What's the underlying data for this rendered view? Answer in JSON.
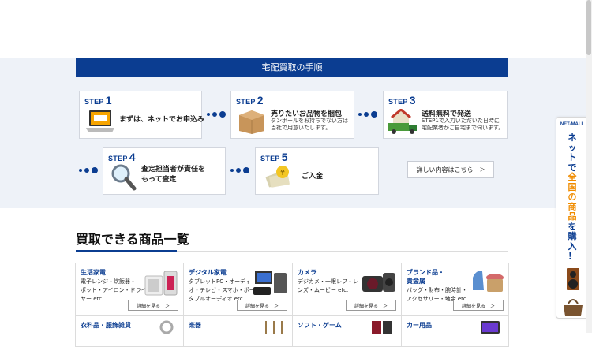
{
  "flow": {
    "heading": "宅配買取の手順",
    "steps": [
      {
        "label": "STEP",
        "num": "1",
        "title": "まずは、ネットでお申込み",
        "sub": ""
      },
      {
        "label": "STEP",
        "num": "2",
        "title": "売りたいお品物を梱包",
        "sub": "ダンボールをお持ちでない方は\n当社で用意いたします。"
      },
      {
        "label": "STEP",
        "num": "3",
        "title": "送料無料で発送",
        "sub": "STEP1で入力いただいた日時に\n宅配業者がご自宅まで伺います。"
      },
      {
        "label": "STEP",
        "num": "4",
        "title": "査定担当者が責任を\nもって査定",
        "sub": ""
      },
      {
        "label": "STEP",
        "num": "5",
        "title": "ご入金",
        "sub": ""
      }
    ],
    "detail_button": "詳しい内容はこちら",
    "detail_arrow": "＞"
  },
  "catalog": {
    "title": "買取できる商品一覧",
    "items": [
      {
        "title": "生活家電",
        "desc": "電子レンジ・炊飯器・\nポット・アイロン・ドライ\nヤー etc.",
        "button": "詳細を見る"
      },
      {
        "title": "デジタル家電",
        "desc": "タブレットPC・オーディ\nオ・テレビ・スマホ・ポー\nタブルオーディオ etc.",
        "button": "詳細を見る"
      },
      {
        "title": "カメラ",
        "desc": "デジカメ・一眼レフ・レ\nンズ・ムービー etc.",
        "button": "詳細を見る"
      },
      {
        "title": "ブランド品・\n貴金属",
        "desc": "\nバッグ・財布・腕時計・\nアクセサリー・地金 etc.",
        "button": "詳細を見る"
      },
      {
        "title": "衣料品・服飾雑貨",
        "desc": "",
        "button": ""
      },
      {
        "title": "楽器",
        "desc": "",
        "button": ""
      },
      {
        "title": "ソフト・ゲーム",
        "desc": "",
        "button": ""
      },
      {
        "title": "カー用品",
        "desc": "",
        "button": ""
      }
    ],
    "button_arrow": "＞"
  },
  "netmall": {
    "header": "NET-MALL",
    "vertical_text": "ネットで全国の商品を購入！"
  },
  "colors": {
    "brand_blue": "#0b3d91",
    "accent_orange": "#f08c00",
    "flow_bg": "#eef2f8"
  }
}
